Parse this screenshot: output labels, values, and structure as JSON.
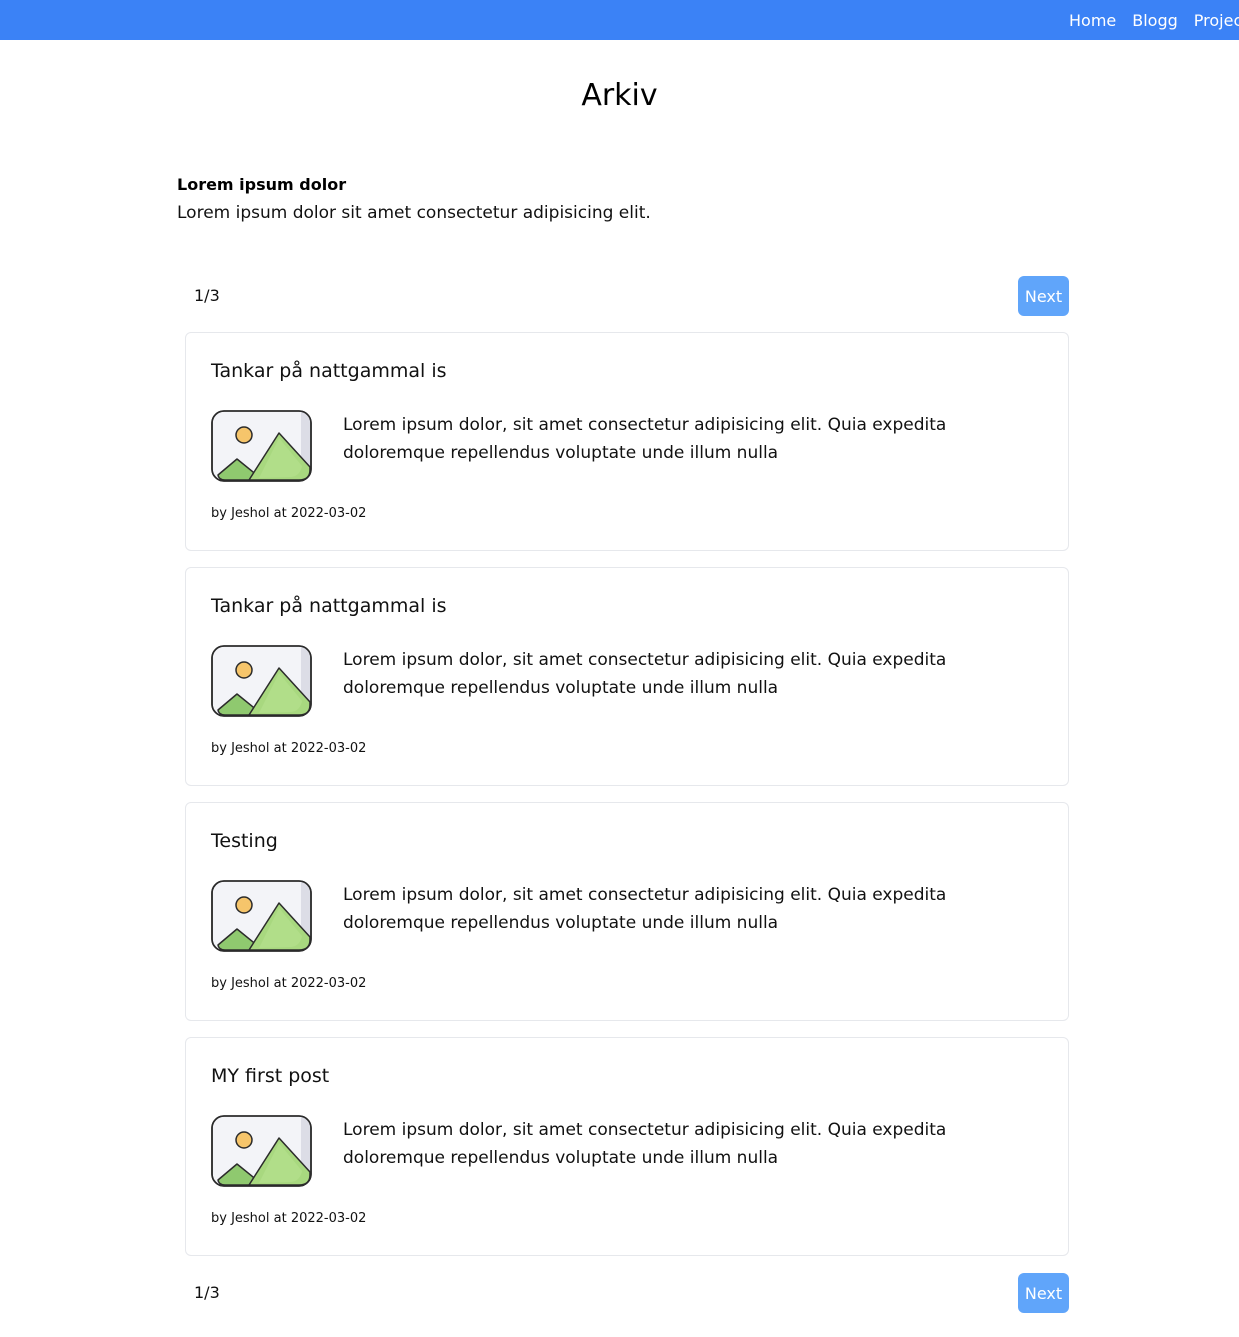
{
  "nav": {
    "items": [
      "Home",
      "Blogg",
      "Project"
    ]
  },
  "page": {
    "title": "Arkiv"
  },
  "intro": {
    "title": "Lorem ipsum dolor",
    "text": "Lorem ipsum dolor sit amet consectetur adipisicing elit."
  },
  "pagination": {
    "count": "1/3",
    "next_label": "Next"
  },
  "posts": [
    {
      "title": "Tankar på nattgammal is",
      "body": "Lorem ipsum dolor, sit amet consectetur adipisicing elit. Quia expedita doloremque repellendus voluptate unde illum nulla",
      "meta": "by Jeshol at 2022-03-02"
    },
    {
      "title": "Tankar på nattgammal is",
      "body": "Lorem ipsum dolor, sit amet consectetur adipisicing elit. Quia expedita doloremque repellendus voluptate unde illum nulla",
      "meta": "by Jeshol at 2022-03-02"
    },
    {
      "title": "Testing",
      "body": "Lorem ipsum dolor, sit amet consectetur adipisicing elit. Quia expedita doloremque repellendus voluptate unde illum nulla",
      "meta": "by Jeshol at 2022-03-02"
    },
    {
      "title": "MY first post",
      "body": "Lorem ipsum dolor, sit amet consectetur adipisicing elit. Quia expedita doloremque repellendus voluptate unde illum nulla",
      "meta": "by Jeshol at 2022-03-02"
    }
  ],
  "icons": {
    "thumbnail": "image-placeholder-icon"
  },
  "colors": {
    "nav_bar": "#3b82f6",
    "next_button": "#60a5fa"
  }
}
